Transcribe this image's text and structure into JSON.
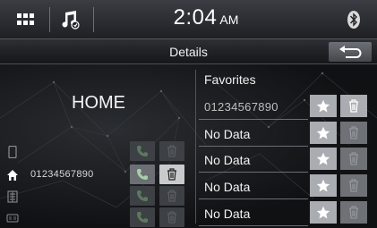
{
  "status_bar": {
    "time": "2:04",
    "ampm": "AM",
    "menu_icon": "grid-menu-icon",
    "music_icon": "music-note-icon",
    "bluetooth_icon": "bluetooth-icon"
  },
  "header": {
    "title": "Details",
    "back_icon": "back-arrow-icon"
  },
  "contact": {
    "name": "HOME",
    "numbers": [
      {
        "type_icon": "mobile-phone-icon",
        "number": "",
        "active": false
      },
      {
        "type_icon": "home-icon",
        "number": "01234567890",
        "active": true
      },
      {
        "type_icon": "office-icon",
        "number": "",
        "active": false
      },
      {
        "type_icon": "other-icon",
        "number": "",
        "active": false
      }
    ]
  },
  "favorites": {
    "title": "Favorites",
    "items": [
      {
        "label": "01234567890",
        "is_number": true,
        "deletable": true
      },
      {
        "label": "No Data",
        "is_number": false,
        "deletable": false
      },
      {
        "label": "No Data",
        "is_number": false,
        "deletable": false
      },
      {
        "label": "No Data",
        "is_number": false,
        "deletable": false
      },
      {
        "label": "No Data",
        "is_number": false,
        "deletable": false
      }
    ]
  },
  "colors": {
    "background": "#0c0d0f",
    "button_light": "#a9acb0",
    "button_dim": "#3d4044"
  }
}
